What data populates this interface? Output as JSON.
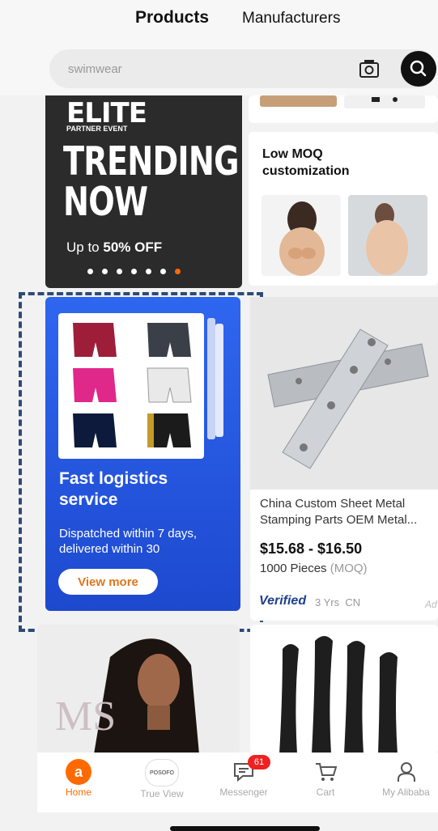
{
  "header": {
    "tab_products": "Products",
    "tab_manufacturers": "Manufacturers",
    "search_placeholder": "swimwear"
  },
  "banner": {
    "brand": "ELITE",
    "subbrand": "PARTNER EVENT",
    "headline_line1": "TRENDING",
    "headline_line2": "NOW",
    "offer_prefix": "Up to ",
    "offer_value": "50% OFF",
    "carousel_pages": 7,
    "active_page": 7
  },
  "low_moq": {
    "title": "Low MOQ customization"
  },
  "logistics": {
    "title": "Fast logistics service",
    "subtitle": "Dispatched within 7 days, delivered within 30",
    "button": "View more"
  },
  "product": {
    "title": "China Custom Sheet Metal Stamping Parts OEM Metal...",
    "price": "$15.68 - $16.50",
    "moq_qty": "1000 Pieces",
    "moq_label": "(MOQ)",
    "verified": "Verified",
    "years": "3 Yrs",
    "country": "CN",
    "ad": "Ad"
  },
  "nav": {
    "items": [
      {
        "label": "Home",
        "icon": "alibaba-logo-icon",
        "active": true
      },
      {
        "label": "True View",
        "icon": "true-view-icon",
        "active": false
      },
      {
        "label": "Messenger",
        "icon": "chat-icon",
        "active": false
      },
      {
        "label": "Cart",
        "icon": "cart-icon",
        "active": false
      },
      {
        "label": "My Alibaba",
        "icon": "user-icon",
        "active": false
      }
    ],
    "messenger_badge": "61",
    "true_view_logo_text": "POSOFO"
  },
  "colors": {
    "accent": "#ff6a00",
    "banner_bg": "#2b2b2b",
    "logistics_blue": "#2f66f0",
    "verified": "#1e3f8c"
  }
}
